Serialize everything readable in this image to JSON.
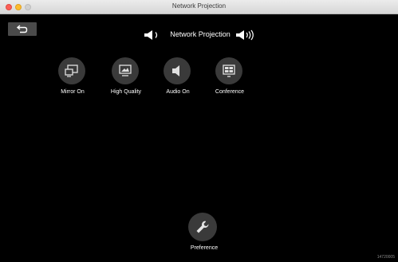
{
  "window": {
    "title": "Network Projection"
  },
  "back_button": {
    "icon": "back-arrow-icon"
  },
  "header": {
    "title": "Network Projection",
    "volume_down_icon": "volume-down-icon",
    "volume_up_icon": "volume-up-icon"
  },
  "features": [
    {
      "label": "Mirror On",
      "icon": "mirror-screen-icon"
    },
    {
      "label": "High Quality",
      "icon": "high-quality-icon"
    },
    {
      "label": "Audio On",
      "icon": "speaker-icon"
    },
    {
      "label": "Conference",
      "icon": "conference-icon"
    }
  ],
  "preference": {
    "label": "Preference",
    "icon": "wrench-icon"
  },
  "version": "14720005"
}
